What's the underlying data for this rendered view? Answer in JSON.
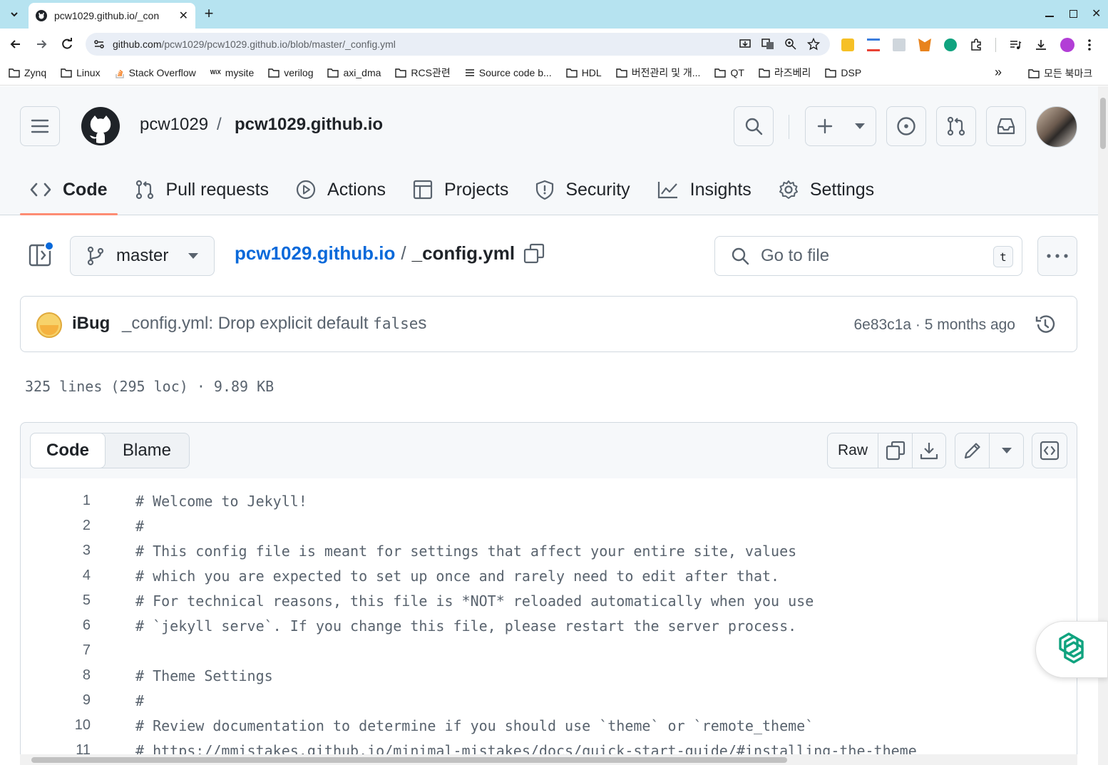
{
  "browser": {
    "tab_title": "pcw1029.github.io/_con",
    "url_host": "github.com",
    "url_path": "/pcw1029/pcw1029.github.io/blob/master/_config.yml",
    "bookmarks": [
      "Zynq",
      "Linux",
      "Stack Overflow",
      "mysite",
      "verilog",
      "axi_dma",
      "RCS관련",
      "Source code b...",
      "HDL",
      "버전관리 및 개...",
      "QT",
      "라즈베리",
      "DSP"
    ],
    "bookmarks_overflow": "»",
    "all_bookmarks": "모든 북마크"
  },
  "repo": {
    "owner": "pcw1029",
    "separator": "/",
    "name": "pcw1029.github.io"
  },
  "nav": {
    "code": "Code",
    "pull_requests": "Pull requests",
    "actions": "Actions",
    "projects": "Projects",
    "security": "Security",
    "insights": "Insights",
    "settings": "Settings"
  },
  "file": {
    "branch": "master",
    "repo_link": "pcw1029.github.io",
    "slash": "/",
    "name": "_config.yml",
    "goto_placeholder": "Go to file",
    "goto_shortcut": "t"
  },
  "commit": {
    "author": "iBug",
    "message_prefix": "_config.yml: Drop explicit default ",
    "message_code": "false",
    "message_suffix": "s",
    "sha": "6e83c1a",
    "dot": "·",
    "age": "5 months ago"
  },
  "stats": "325 lines (295 loc) · 9.89 KB",
  "blob_header": {
    "code_tab": "Code",
    "blame_tab": "Blame",
    "raw": "Raw"
  },
  "code_lines": [
    {
      "n": "1",
      "t": "# Welcome to Jekyll!"
    },
    {
      "n": "2",
      "t": "#"
    },
    {
      "n": "3",
      "t": "# This config file is meant for settings that affect your entire site, values"
    },
    {
      "n": "4",
      "t": "# which you are expected to set up once and rarely need to edit after that."
    },
    {
      "n": "5",
      "t": "# For technical reasons, this file is *NOT* reloaded automatically when you use"
    },
    {
      "n": "6",
      "t": "# `jekyll serve`. If you change this file, please restart the server process."
    },
    {
      "n": "7",
      "t": ""
    },
    {
      "n": "8",
      "t": "# Theme Settings"
    },
    {
      "n": "9",
      "t": "#"
    },
    {
      "n": "10",
      "t": "# Review documentation to determine if you should use `theme` or `remote_theme`"
    },
    {
      "n": "11",
      "t": "# https://mmistakes.github.io/minimal-mistakes/docs/quick-start-guide/#installing-the-theme"
    }
  ],
  "colors": {
    "tabstrip": "#b6e3f0",
    "link": "#0969da",
    "nav_underline": "#fd8c73",
    "notification_dot": "#0969da"
  }
}
